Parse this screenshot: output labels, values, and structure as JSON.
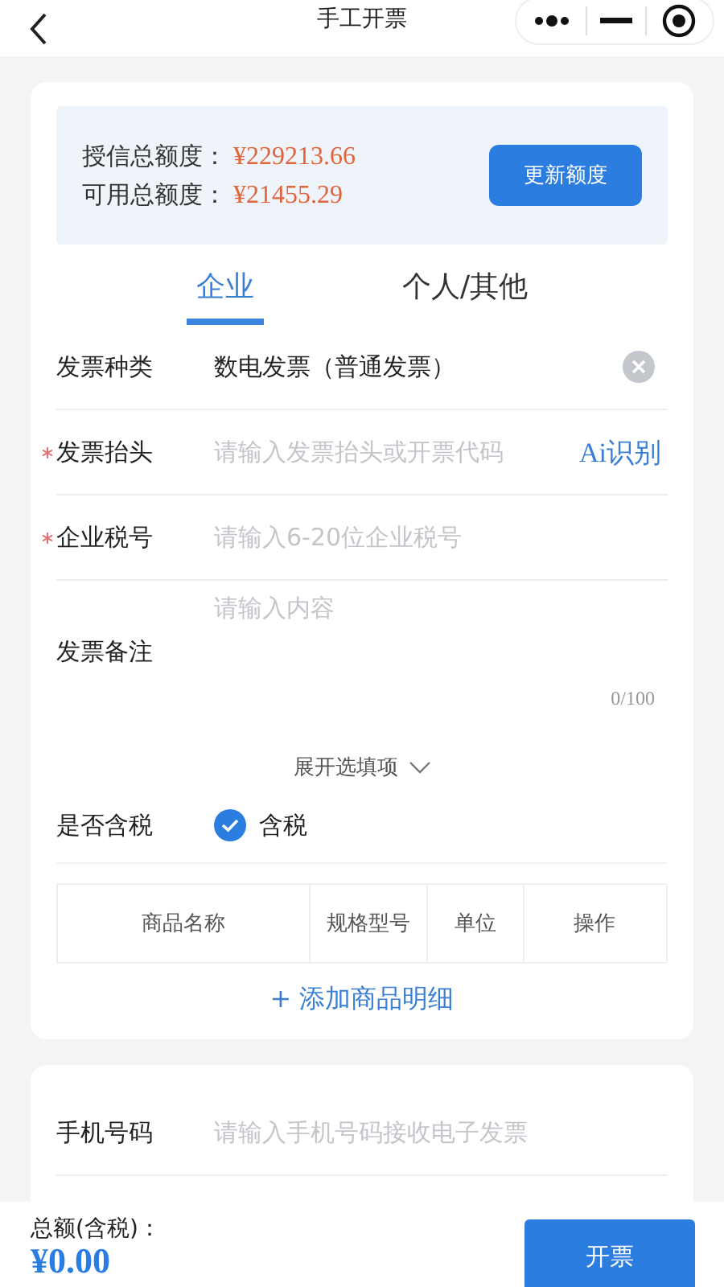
{
  "nav": {
    "title": "手工开票"
  },
  "quota": {
    "lines": [
      {
        "label": "授信总额度：",
        "value": "¥229213.66"
      },
      {
        "label": "可用总额度：",
        "value": "¥21455.29"
      }
    ],
    "button": "更新额度"
  },
  "tabs": [
    {
      "label": "企业",
      "selected": true
    },
    {
      "label": "个人/其他",
      "selected": false
    }
  ],
  "fields": [
    {
      "kind": "select",
      "label": "发票种类",
      "required": false,
      "value": "数电发票（普通发票）"
    },
    {
      "kind": "input",
      "label": "发票抬头",
      "required": true,
      "placeholder": "请输入发票抬头或开票代码",
      "action": "Ai识别"
    },
    {
      "kind": "input",
      "label": "企业税号",
      "required": true,
      "placeholder": "请输入6-20位企业税号"
    },
    {
      "kind": "textarea",
      "label": "发票备注",
      "required": false,
      "placeholder": "请输入内容",
      "counter": "0/100"
    }
  ],
  "expand_link": "展开选填项",
  "tax": {
    "label": "是否含税",
    "option": "含税",
    "checked": true
  },
  "goods_table": {
    "columns": [
      "商品名称",
      "规格型号",
      "单位",
      "操作"
    ]
  },
  "add_goods": "+ 添加商品明细",
  "contact_fields": [
    {
      "kind": "input",
      "label": "手机号码",
      "required": false,
      "placeholder": "请输入手机号码接收电子发票"
    }
  ],
  "footer": {
    "total_label": "总额(含税)：",
    "total": "¥0.00",
    "button": "开票"
  }
}
